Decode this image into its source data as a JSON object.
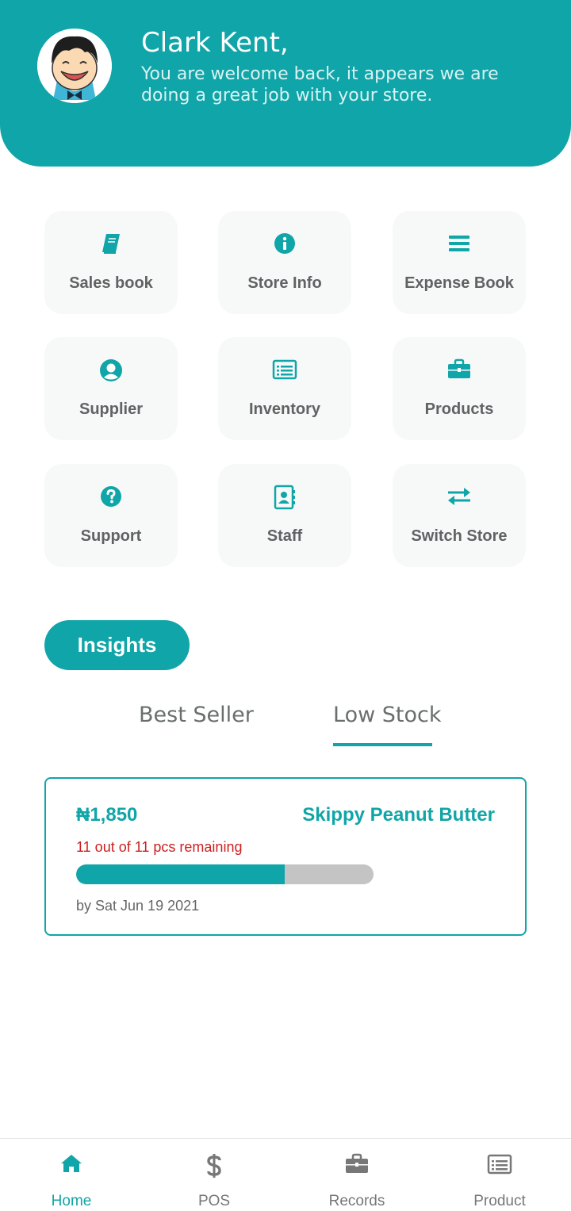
{
  "header": {
    "name": "Clark Kent,",
    "message": "You are welcome back, it appears we are doing a great job with your store."
  },
  "menu": [
    {
      "label": "Sales book",
      "icon": "book-icon"
    },
    {
      "label": "Store Info",
      "icon": "info-icon"
    },
    {
      "label": "Expense Book",
      "icon": "list-icon"
    },
    {
      "label": "Supplier",
      "icon": "user-circle-icon"
    },
    {
      "label": "Inventory",
      "icon": "list-alt-icon"
    },
    {
      "label": "Products",
      "icon": "briefcase-icon"
    },
    {
      "label": "Support",
      "icon": "question-circle-icon"
    },
    {
      "label": "Staff",
      "icon": "address-book-icon"
    },
    {
      "label": "Switch Store",
      "icon": "exchange-icon"
    }
  ],
  "insights": {
    "button_label": "Insights",
    "tabs": [
      "Best Seller",
      "Low Stock"
    ],
    "active_tab": "Low Stock"
  },
  "low_stock_card": {
    "price": "₦1,850",
    "product_name": "Skippy Peanut Butter",
    "remaining": "11 out of 11 pcs remaining",
    "stock_level_percent": 70,
    "date": "by Sat Jun 19 2021"
  },
  "bottom_nav": [
    {
      "label": "Home",
      "icon": "home-icon",
      "active": true
    },
    {
      "label": "POS",
      "icon": "dollar-icon",
      "active": false
    },
    {
      "label": "Records",
      "icon": "briefcase-icon",
      "active": false
    },
    {
      "label": "Product",
      "icon": "list-alt-icon",
      "active": false
    }
  ],
  "colors": {
    "accent": "#10a5a8",
    "warning_text": "#cc1f1f",
    "tile_background": "#f7f9f9",
    "progress_track": "#c4c4c4"
  }
}
